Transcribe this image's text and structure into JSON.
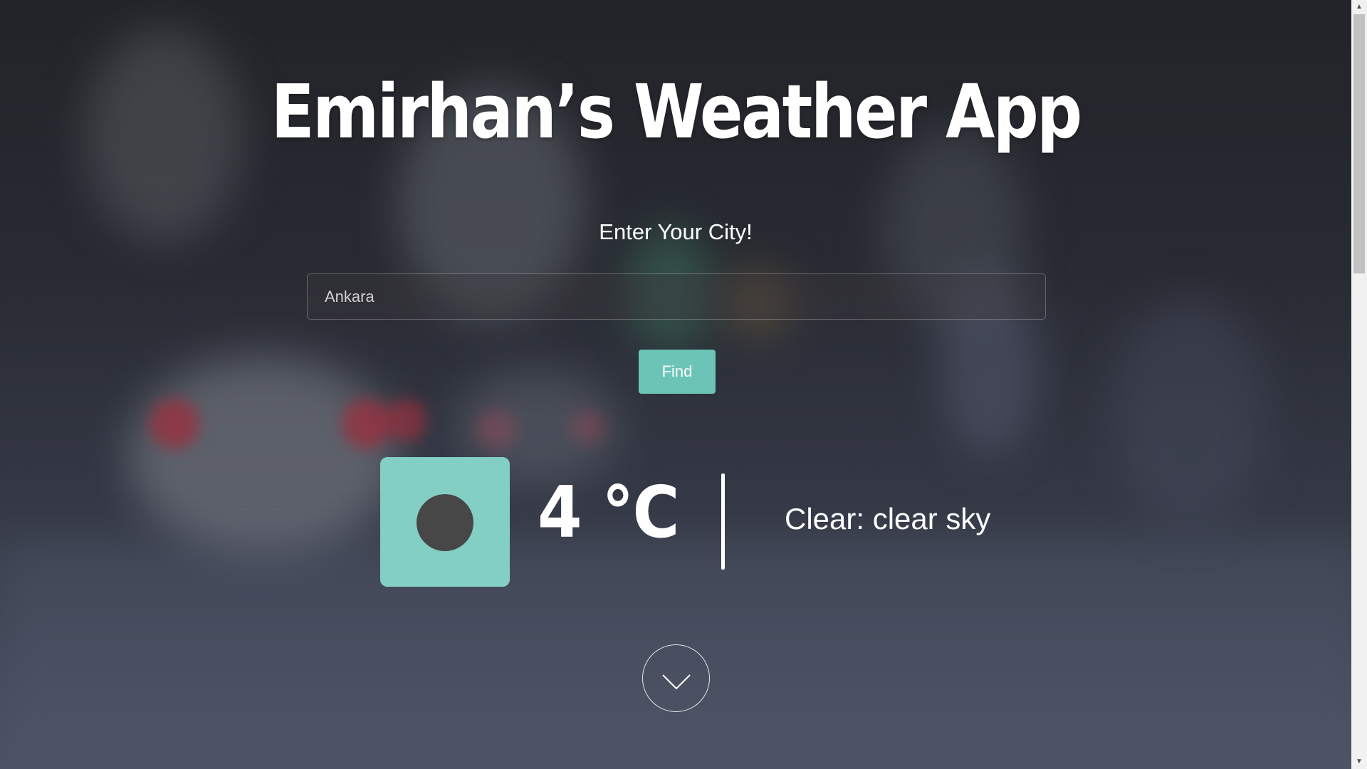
{
  "app": {
    "title": "Emirhan’s Weather App",
    "prompt": "Enter Your City!"
  },
  "search": {
    "placeholder": "Ankara",
    "value": ""
  },
  "find_button": {
    "label": "Find"
  },
  "weather": {
    "temperature": "4 °C",
    "condition": "Clear: clear sky",
    "icon": "clear-sky-icon"
  },
  "scroll_down": {
    "icon": "chevron-down-icon"
  },
  "colors": {
    "accent": "#6cc4b7",
    "icon_box": "#84cfc4",
    "icon_dot": "#474747",
    "text": "#ffffff"
  }
}
